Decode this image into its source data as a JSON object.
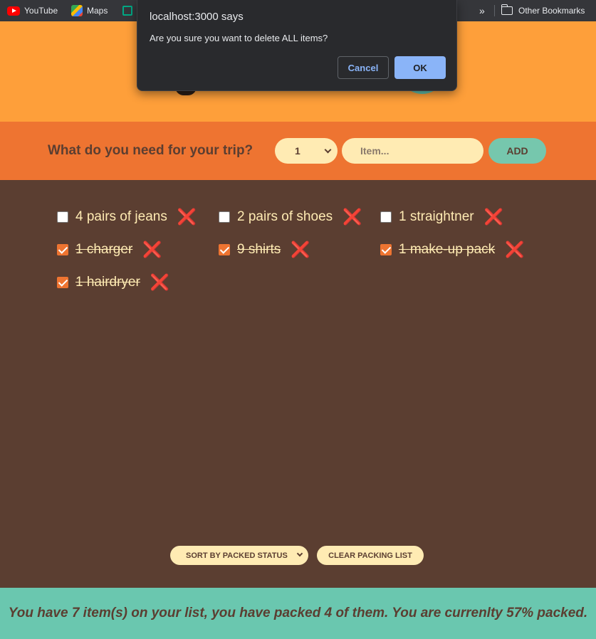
{
  "browser": {
    "bookmarks": [
      {
        "label": "YouTube",
        "icon": "youtube-icon"
      },
      {
        "label": "Maps",
        "icon": "maps-icon"
      }
    ],
    "overflow_label": "»",
    "other_bookmarks": "Other Bookmarks"
  },
  "dialog": {
    "title": "localhost:3000 says",
    "message": "Are you sure you want to delete ALL items?",
    "cancel_label": "Cancel",
    "ok_label": "OK"
  },
  "form": {
    "title": "What do you need for your trip?",
    "quantity_value": "1",
    "item_placeholder": "Item...",
    "add_label": "ADD"
  },
  "items": [
    {
      "label": "4 pairs of jeans",
      "packed": false
    },
    {
      "label": "2 pairs of shoes",
      "packed": false
    },
    {
      "label": "1 straightner",
      "packed": false
    },
    {
      "label": "1 charger",
      "packed": true
    },
    {
      "label": "9 shirts",
      "packed": true
    },
    {
      "label": "1 make-up pack",
      "packed": true
    },
    {
      "label": "1 hairdryer",
      "packed": true
    }
  ],
  "delete_glyph": "❌",
  "actions": {
    "sort_value": "SORT BY PACKED STATUS",
    "clear_label": "CLEAR PACKING LIST"
  },
  "stats": {
    "text": "You have 7 item(s) on your list, you have packed 4 of them. You are currenlty 57% packed."
  },
  "colors": {
    "header": "#fe9f3a",
    "form": "#ee7431",
    "list": "#5b3e31",
    "stats": "#6ac7af",
    "cream": "#ffebb3"
  }
}
